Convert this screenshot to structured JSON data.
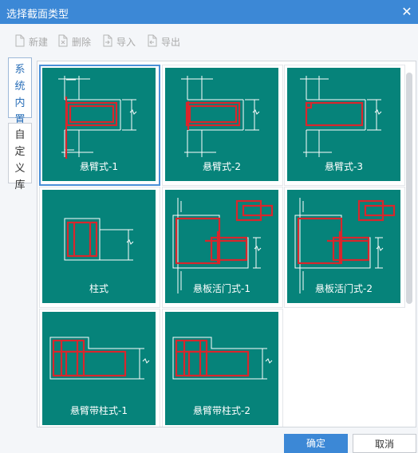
{
  "window": {
    "title": "选择截面类型"
  },
  "toolbar": {
    "new_label": "新建",
    "delete_label": "删除",
    "import_label": "导入",
    "export_label": "导出"
  },
  "sidebar": {
    "tabs": [
      {
        "label": "系统内置",
        "active": true
      },
      {
        "label": "自定义库",
        "active": false
      }
    ]
  },
  "grid": {
    "items": [
      {
        "label": "悬臂式-1",
        "selected": true
      },
      {
        "label": "悬臂式-2",
        "selected": false
      },
      {
        "label": "悬臂式-3",
        "selected": false
      },
      {
        "label": "柱式",
        "selected": false
      },
      {
        "label": "悬板活门式-1",
        "selected": false
      },
      {
        "label": "悬板活门式-2",
        "selected": false
      },
      {
        "label": "悬臂带柱式-1",
        "selected": false
      },
      {
        "label": "悬臂带柱式-2",
        "selected": false
      }
    ]
  },
  "footer": {
    "ok_label": "确定",
    "cancel_label": "取消"
  },
  "colors": {
    "accent": "#3c88d6",
    "thumbnail_bg": "#06837a",
    "rebar": "#d9262c"
  }
}
